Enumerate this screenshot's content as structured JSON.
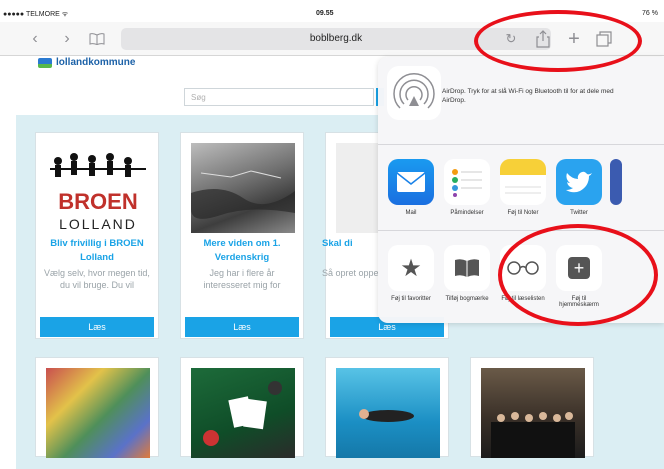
{
  "status": {
    "carrier": "●●●●● TELMORE ᯤ",
    "time": "09.55",
    "battery": "76 %"
  },
  "toolbar": {
    "url": "boblberg.dk"
  },
  "site": {
    "logo": "lollandkommune",
    "search_placeholder": "Søg"
  },
  "cards": [
    {
      "title": "Bliv frivillig i BROEN Lolland",
      "desc": "Vælg selv, hvor megen tid, du vil bruge. Du vil",
      "button": "Læs",
      "logo_top": "BROEN",
      "logo_bottom": "LOLLAND"
    },
    {
      "title": "Mere viden om 1. Verdenskrig",
      "desc": "Jeg har i flere år interesseret mig for",
      "button": "Læs"
    },
    {
      "title": "Skal di",
      "desc": "Så opret oppe i",
      "button": "Læs"
    }
  ],
  "share": {
    "airdrop_text": "AirDrop. Tryk for at slå Wi-Fi og Bluetooth til for at dele med AirDrop.",
    "apps": [
      "Mail",
      "Påmindelser",
      "Føj til Noter",
      "Twitter"
    ],
    "actions": [
      "Føj til favoritter",
      "Tilføj bogmærke",
      "Føj til læselisten",
      "Føj til hjemmeskærm"
    ]
  },
  "colors": {
    "accent": "#1aa3e6",
    "annotation": "#e8101a",
    "page_bg": "#dbeef3"
  }
}
